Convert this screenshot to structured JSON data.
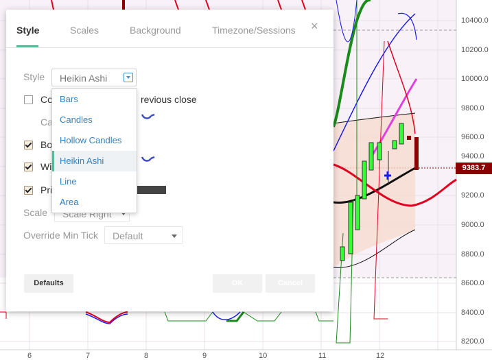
{
  "price_axis": [
    "10400.0",
    "10200.0",
    "10000.0",
    "9800.0",
    "9600.0",
    "9400.0",
    "9200.0",
    "9000.0",
    "8800.0",
    "8600.0",
    "8400.0",
    "8200.0"
  ],
  "last_price": "9383.7",
  "time_axis": [
    "6",
    "7",
    "8",
    "9",
    "10",
    "11",
    "12"
  ],
  "colors": {
    "accent": "#5cb69a",
    "link": "#3a7fb8",
    "last_price_bg": "#8b0000",
    "candle_up": "#33ff33",
    "candle_down": "#8b0000"
  },
  "dialog": {
    "tabs": [
      "Style",
      "Scales",
      "Background",
      "Timezone/Sessions"
    ],
    "active_tab": "Style",
    "close_icon": "×",
    "style_row": {
      "label": "Style",
      "value": "Heikin Ashi"
    },
    "color_bars_row": {
      "label_start": "Co",
      "label_end": "revious close",
      "checked": false
    },
    "candles_label_partial": "Ca",
    "body_row": {
      "label": "Bo",
      "checked": true
    },
    "wick_row": {
      "label": "Wi",
      "checked": true
    },
    "price_line_row": {
      "label": "Pri",
      "checked": true
    },
    "scale_row": {
      "label": "Scale",
      "value": "Scale Right"
    },
    "min_tick_row": {
      "label": "Override Min Tick",
      "value": "Default"
    },
    "buttons": {
      "defaults": "Defaults",
      "ok": "OK",
      "cancel": "Cancel"
    }
  },
  "style_dropdown": {
    "options": [
      "Bars",
      "Candles",
      "Hollow Candles",
      "Heikin Ashi",
      "Line",
      "Area"
    ],
    "selected": "Heikin Ashi"
  }
}
